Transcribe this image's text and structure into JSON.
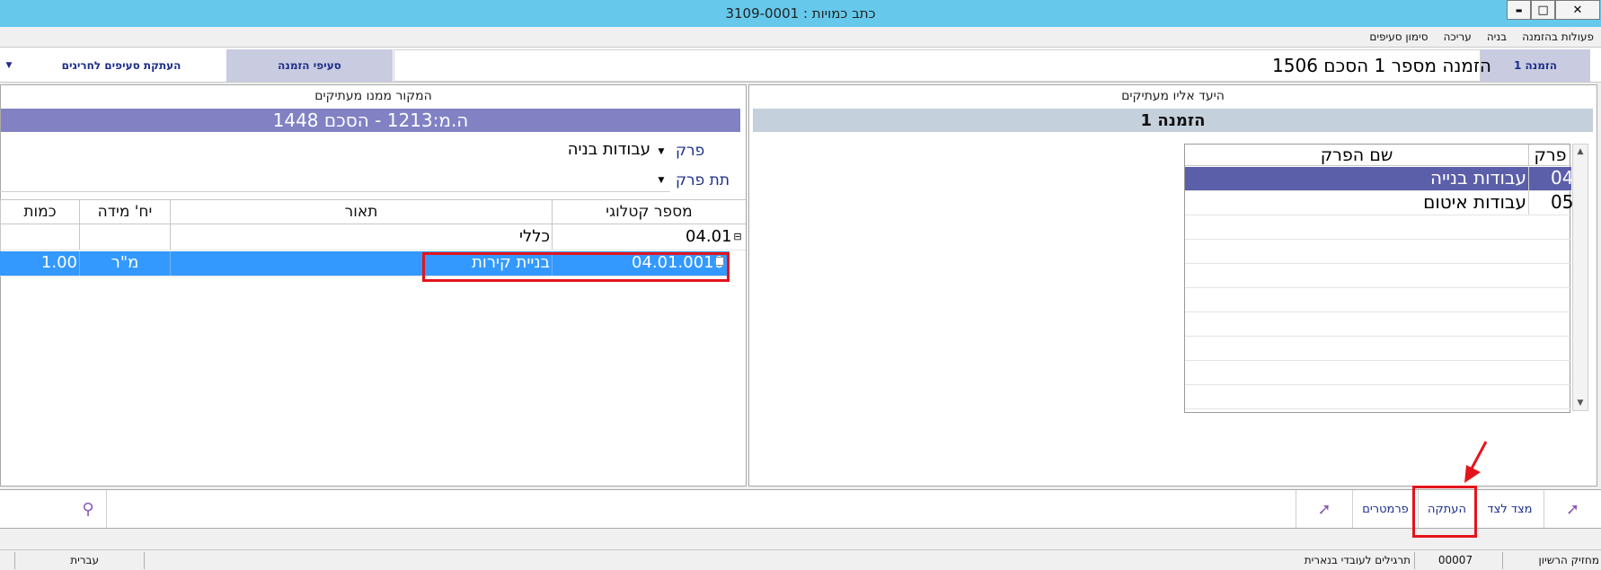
{
  "window": {
    "title": "כתב כמויות : 3109-0001",
    "minimize": "▬",
    "maximize": "□",
    "close": "✕"
  },
  "menu": [
    "פעולות בהזמנה",
    "בניה",
    "עריכה",
    "סימון סעיפים"
  ],
  "tabs": {
    "order_tab": "הזמנה 1",
    "order_items": "סעיפי הזמנה",
    "copy_exceptions": "העתקת סעיפים לחריגים",
    "dropdown_arrow": "▼"
  },
  "order_title": "הזמנה מספר 1 הסכם 1506",
  "target_panel": {
    "caption": "היעד אליו מעתיקים",
    "band": "הזמנה 1",
    "grid_headers": {
      "num": "פרק",
      "name": "שם הפרק"
    },
    "rows": [
      {
        "num": "04",
        "name": "עבודות בנייה"
      },
      {
        "num": "05",
        "name": "עבודות איטום"
      }
    ]
  },
  "source_panel": {
    "caption": "המקור ממנו מעתיקים",
    "band": "ה.מ:1213 - הסכם 1448",
    "chapter_label": "פרק",
    "chapter_value": "עבודות בניה",
    "subchapter_label": "תת פרק",
    "subchapter_value": "",
    "table_headers": {
      "catalog": "מספר קטלוגי",
      "description": "תאור",
      "unit": "יח' מידה",
      "quantity": "כמות"
    },
    "rows": [
      {
        "expander": "⊟",
        "catalog": "04.01",
        "description": "כללי",
        "unit": "",
        "quantity": ""
      },
      {
        "expander": "",
        "catalog": "04.01.0010",
        "description": "בניית קירות",
        "unit": "מ\"ר",
        "quantity": "1.00"
      }
    ]
  },
  "commands": {
    "side_by_side": "מצד לצד",
    "copy": "העתקה",
    "parameters": "פרמטרים"
  },
  "status": {
    "license_holder_label": "מחזיק הרשיון",
    "license_number": "00007",
    "license_name": "תרגילים לעובדי בנארית",
    "language": "עברית"
  },
  "colors": {
    "titlebar": "#66c9ec",
    "accent": "#1c2e8a",
    "selected_row": "#5b5fa9",
    "highlight_row": "#3399ff",
    "source_band": "#8181c4",
    "target_band": "#c4d0dc",
    "annotation": "#e4141b"
  }
}
